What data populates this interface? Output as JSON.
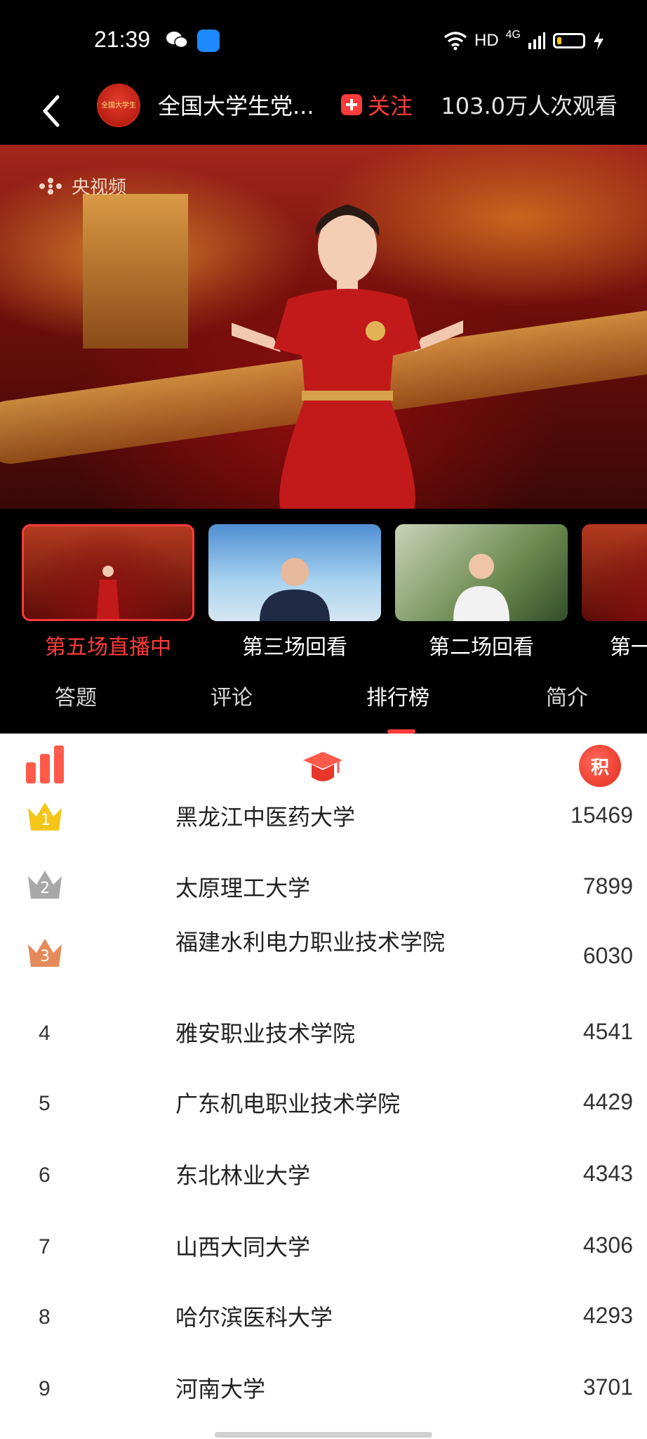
{
  "status_bar": {
    "time": "21:39",
    "network": "HD",
    "cellular": "4G"
  },
  "header": {
    "channel_title": "全国大学生党...",
    "follow_label": "关注",
    "viewers": "103.0万人次观看",
    "avatar_text": "全国大学生"
  },
  "video": {
    "watermark": "央视频"
  },
  "episodes": [
    {
      "label": "第五场直播中",
      "active": true
    },
    {
      "label": "第三场回看",
      "active": false
    },
    {
      "label": "第二场回看",
      "active": false
    },
    {
      "label": "第一",
      "active": false
    }
  ],
  "tabs": [
    {
      "label": "答题"
    },
    {
      "label": "评论"
    },
    {
      "label": "排行榜",
      "active": true
    },
    {
      "label": "简介"
    }
  ],
  "ranking": {
    "points_icon_text": "积",
    "rows": [
      {
        "rank": "1",
        "name": "黑龙江中医药大学",
        "score": "15469"
      },
      {
        "rank": "2",
        "name": "太原理工大学",
        "score": "7899"
      },
      {
        "rank": "3",
        "name": "福建水利电力职业技术学院",
        "score": "6030"
      },
      {
        "rank": "4",
        "name": "雅安职业技术学院",
        "score": "4541"
      },
      {
        "rank": "5",
        "name": "广东机电职业技术学院",
        "score": "4429"
      },
      {
        "rank": "6",
        "name": "东北林业大学",
        "score": "4343"
      },
      {
        "rank": "7",
        "name": "山西大同大学",
        "score": "4306"
      },
      {
        "rank": "8",
        "name": "哈尔滨医科大学",
        "score": "4293"
      },
      {
        "rank": "9",
        "name": "河南大学",
        "score": "3701"
      }
    ]
  },
  "colors": {
    "accent": "#ff3b3b",
    "background_dark": "#000000",
    "gold": "#f5c518",
    "silver": "#a8a8a8",
    "bronze": "#e58a5a"
  }
}
